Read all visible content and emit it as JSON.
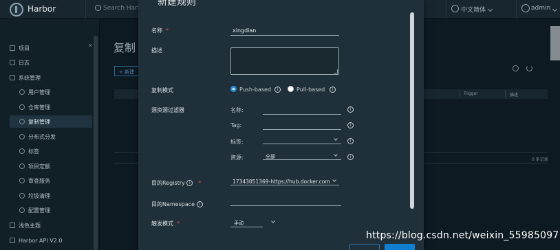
{
  "header": {
    "brand": "Harbor",
    "search_placeholder": "Search Harb",
    "language": "中文简体",
    "user": "admin"
  },
  "sidebar": {
    "items": [
      {
        "label": "项目"
      },
      {
        "label": "日志"
      },
      {
        "label": "系统管理"
      },
      {
        "label": "用户管理"
      },
      {
        "label": "仓库管理"
      },
      {
        "label": "复制管理"
      },
      {
        "label": "分布式分发"
      },
      {
        "label": "标签"
      },
      {
        "label": "项目定额"
      },
      {
        "label": "审查服务"
      },
      {
        "label": "垃圾清理"
      },
      {
        "label": "配置管理"
      },
      {
        "label": "浅色主题"
      },
      {
        "label": "Harbor API V2.0"
      }
    ]
  },
  "main": {
    "title": "复制",
    "new_rule": "+ 新建",
    "columns": [
      "Trigger",
      "描述"
    ],
    "count": "0 条记录"
  },
  "modal": {
    "title": "新建规则",
    "name_label": "名称",
    "name_value": "xingdian",
    "desc_label": "描述",
    "mode_label": "复制模式",
    "mode_push": "Push-based",
    "mode_pull": "Pull-based",
    "filter_label": "源资源过滤器",
    "filter_name": "名称:",
    "filter_tag": "Tag:",
    "filter_label_field": "标签:",
    "filter_resource": "资源:",
    "filter_resource_value": "全部",
    "dest_registry_label": "目的Registry",
    "dest_registry_value": "17343051369-https://hub.docker.com",
    "dest_namespace_label": "目的Namespace",
    "trigger_label": "触发模式",
    "trigger_value": "手动"
  },
  "watermark": "https://blog.csdn.net/weixin_55985097",
  "colors": {
    "accent": "#0f7fcf",
    "required": "#e0514f",
    "modal_bg": "#20303a",
    "page_bg": "#0d1a22"
  }
}
